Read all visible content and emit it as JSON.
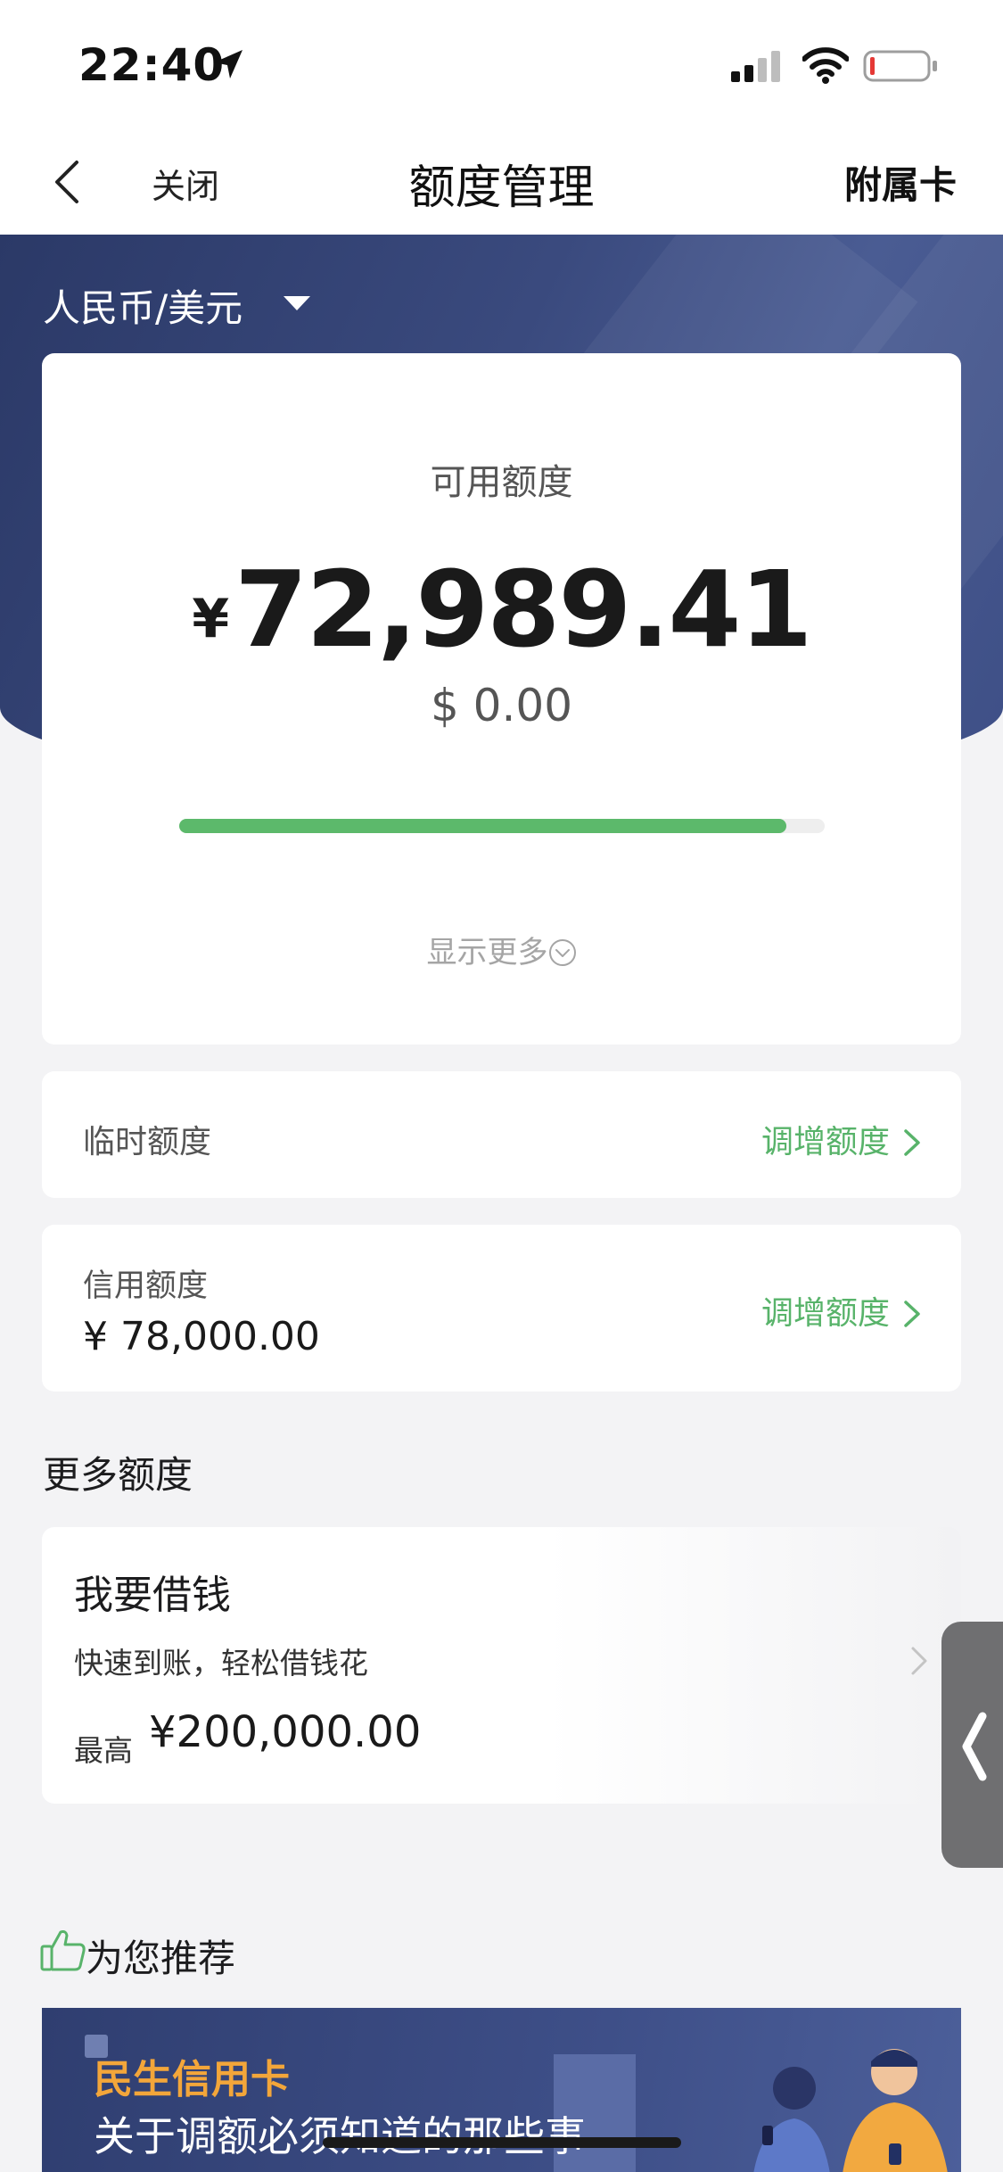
{
  "status_bar": {
    "time": "22:40"
  },
  "nav": {
    "close_label": "关闭",
    "title": "额度管理",
    "right_label": "附属卡"
  },
  "header": {
    "currency_selector": "人民币/美元"
  },
  "available": {
    "label": "可用额度",
    "currency_symbol": "¥",
    "amount": "72,989.41",
    "usd_amount": "$ 0.00",
    "usage_fraction": 0.94,
    "show_more": "显示更多"
  },
  "temp_limit": {
    "label": "临时额度",
    "action": "调增额度"
  },
  "credit_limit": {
    "label": "信用额度",
    "value": "¥ 78,000.00",
    "action": "调增额度"
  },
  "more_limits": {
    "title": "更多额度"
  },
  "borrow": {
    "title": "我要借钱",
    "subtitle": "快速到账，轻松借钱花",
    "max_label": "最高",
    "max_value": "¥200,000.00"
  },
  "recommend": {
    "title": "为您推荐",
    "banner_title": "民生信用卡",
    "banner_subtitle": "关于调额必须知道的那些事"
  },
  "colors": {
    "accent_green": "#58b36a",
    "header_navy": "#3a4a7e",
    "banner_orange": "#f3a63a"
  },
  "icons": [
    "location-arrow-icon",
    "signal-icon",
    "wifi-icon",
    "battery-icon",
    "back-chevron-icon",
    "caret-down-icon",
    "chevron-down-circle-icon",
    "chevron-right-icon",
    "thumbs-up-icon",
    "side-tab-chevron-icon"
  ]
}
